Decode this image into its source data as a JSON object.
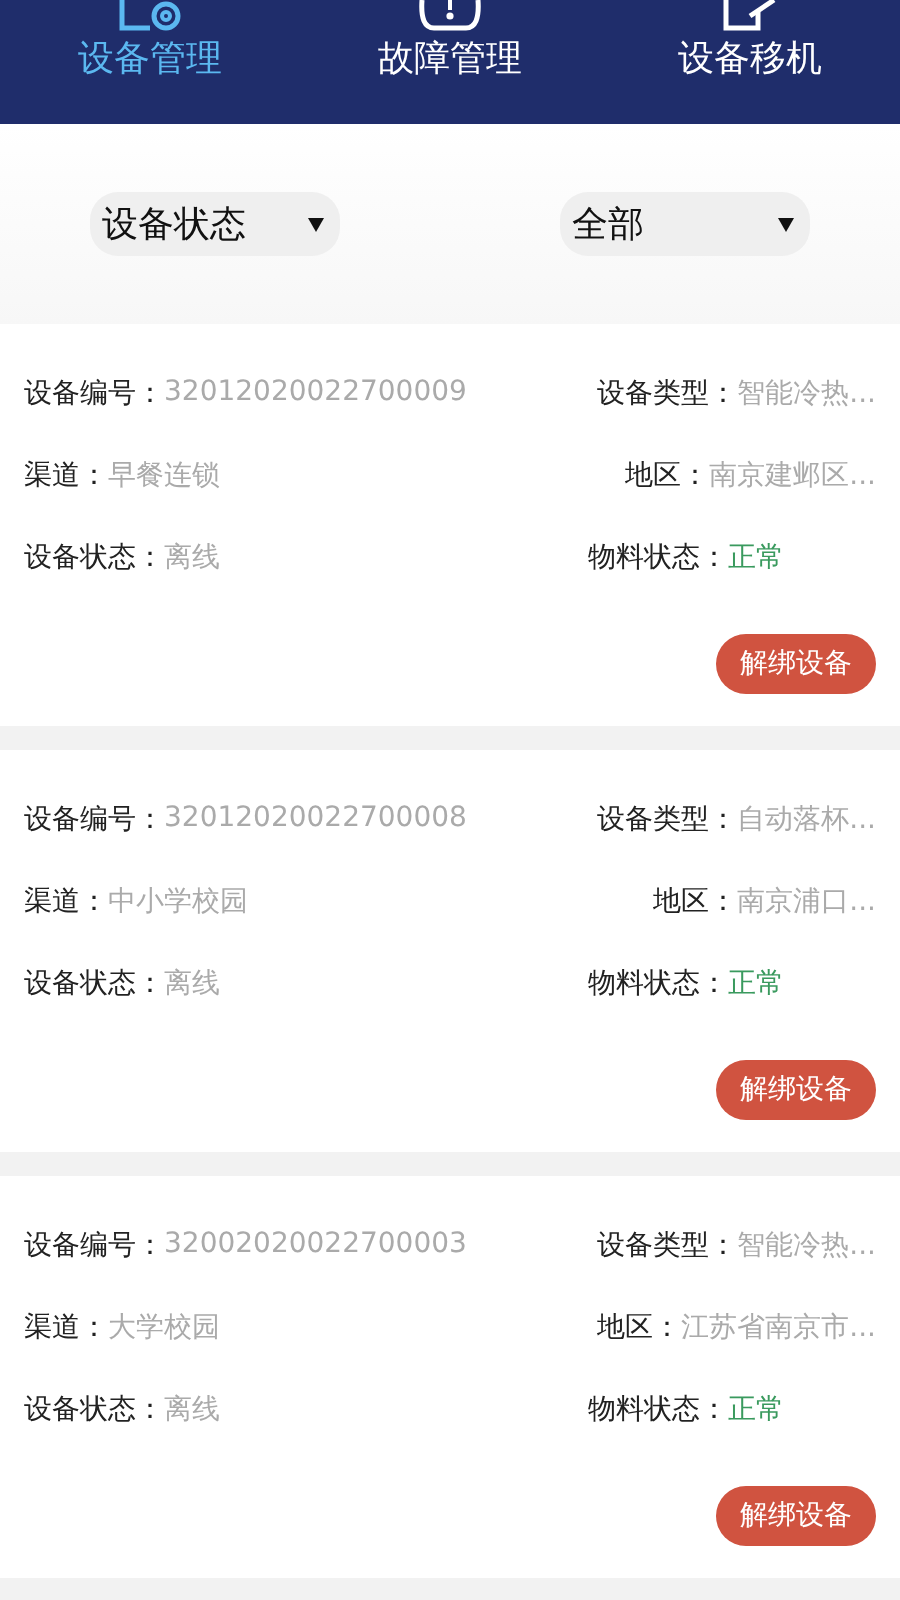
{
  "tabs": [
    {
      "label": "设备管理",
      "selected": true,
      "kind": "device"
    },
    {
      "label": "故障管理",
      "selected": false,
      "kind": "fault"
    },
    {
      "label": "设备移机",
      "selected": false,
      "kind": "move"
    }
  ],
  "filters": [
    {
      "value": "设备状态"
    },
    {
      "value": "全部"
    }
  ],
  "devices": [
    {
      "fields": [
        [
          {
            "label": "设备编号：",
            "value": "32012020022700009",
            "kind": "plain"
          },
          {
            "label": "设备类型：",
            "value": "智能冷热...",
            "kind": "plain"
          }
        ],
        [
          {
            "label": "渠道：",
            "value": "早餐连锁",
            "kind": "plain"
          },
          {
            "label": "地区：",
            "value": "南京建邺区...",
            "kind": "plain"
          }
        ],
        [
          {
            "label": "设备状态：",
            "value": "离线",
            "kind": "plain"
          },
          {
            "label": "物料状态：",
            "value": "正常",
            "kind": "status"
          }
        ]
      ],
      "button": "解绑设备"
    },
    {
      "fields": [
        [
          {
            "label": "设备编号：",
            "value": "32012020022700008",
            "kind": "plain"
          },
          {
            "label": "设备类型：",
            "value": "自动落杯...",
            "kind": "plain"
          }
        ],
        [
          {
            "label": "渠道：",
            "value": "中小学校园",
            "kind": "plain"
          },
          {
            "label": "地区：",
            "value": "南京浦口...",
            "kind": "plain"
          }
        ],
        [
          {
            "label": "设备状态：",
            "value": "离线",
            "kind": "plain"
          },
          {
            "label": "物料状态：",
            "value": "正常",
            "kind": "status"
          }
        ]
      ],
      "button": "解绑设备"
    },
    {
      "fields": [
        [
          {
            "label": "设备编号：",
            "value": "32002020022700003",
            "kind": "plain"
          },
          {
            "label": "设备类型：",
            "value": "智能冷热...",
            "kind": "plain"
          }
        ],
        [
          {
            "label": "渠道：",
            "value": "大学校园",
            "kind": "plain"
          },
          {
            "label": "地区：",
            "value": "江苏省南京市...",
            "kind": "plain"
          }
        ],
        [
          {
            "label": "设备状态：",
            "value": "离线",
            "kind": "plain"
          },
          {
            "label": "物料状态：",
            "value": "正常",
            "kind": "status"
          }
        ]
      ],
      "button": "解绑设备"
    }
  ]
}
